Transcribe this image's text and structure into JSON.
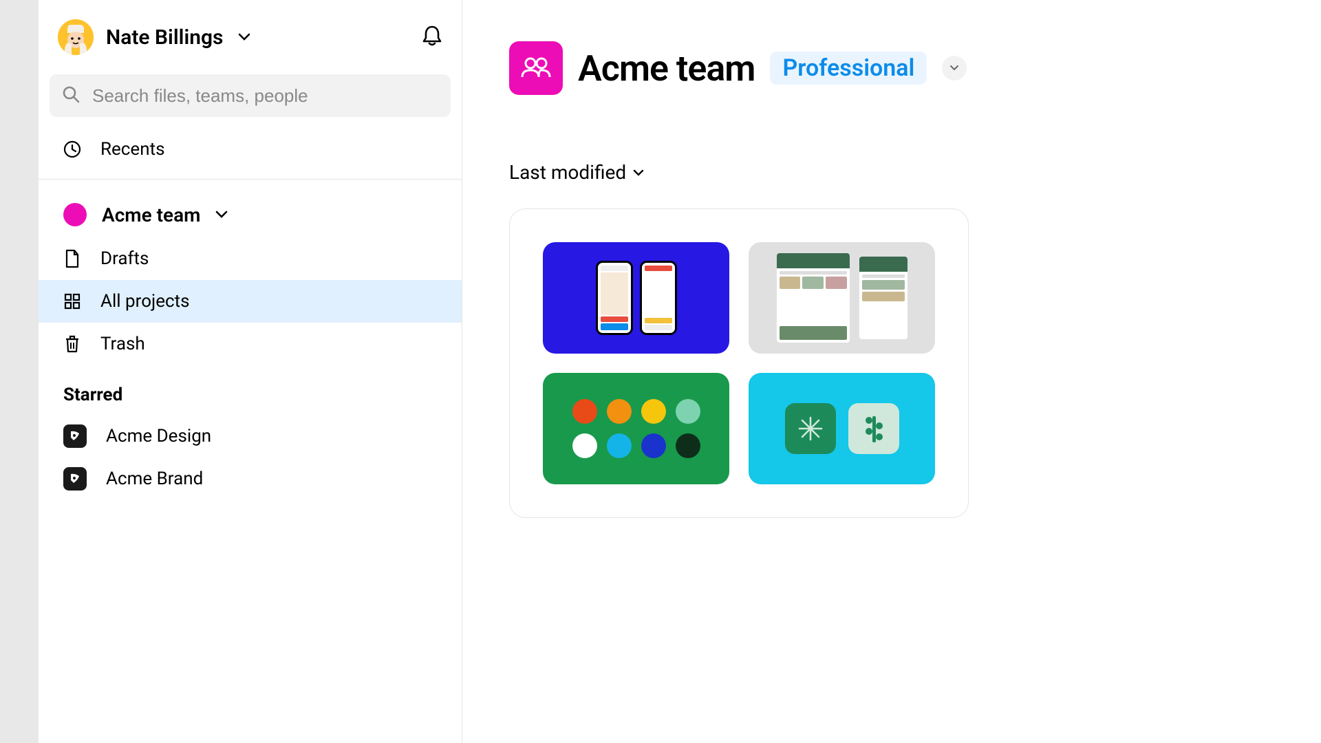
{
  "user": {
    "name": "Nate Billings"
  },
  "search": {
    "placeholder": "Search files, teams, people"
  },
  "sidebar": {
    "recents": "Recents",
    "team": "Acme team",
    "drafts": "Drafts",
    "all_projects": "All projects",
    "trash": "Trash",
    "starred_title": "Starred",
    "starred": [
      {
        "label": "Acme Design"
      },
      {
        "label": "Acme Brand"
      }
    ]
  },
  "main": {
    "team_title": "Acme team",
    "plan": "Professional",
    "sort": "Last modified"
  },
  "colors": {
    "magenta": "#ed0db6",
    "blue_link": "#0c8ce9"
  }
}
